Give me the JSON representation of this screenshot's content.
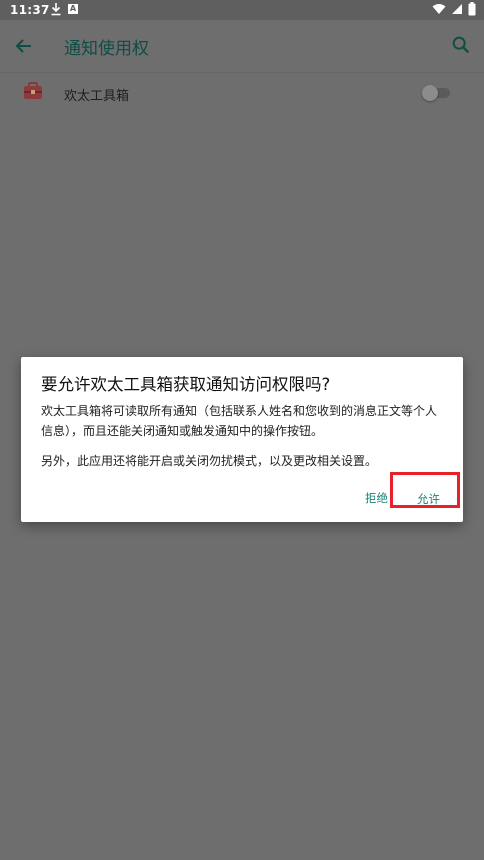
{
  "status_bar": {
    "time": "11:37",
    "notification_icons": [
      "download-icon",
      "a-badge-icon"
    ],
    "right_icons": [
      "wifi-icon",
      "signal-icon",
      "battery-icon"
    ]
  },
  "app_bar": {
    "title": "通知使用权"
  },
  "list": {
    "items": [
      {
        "label": "欢太工具箱",
        "toggle_on": false
      }
    ]
  },
  "dialog": {
    "title": "要允许欢太工具箱获取通知访问权限吗?",
    "body_1": "欢太工具箱将可读取所有通知（包括联系人姓名和您收到的消息正文等个人信息），而且还能关闭通知或触发通知中的操作按钮。",
    "body_2": "另外，此应用还将能开启或关闭勿扰模式，以及更改相关设置。",
    "deny_label": "拒绝",
    "allow_label": "允许"
  },
  "colors": {
    "accent": "#1a8578",
    "title": "#0f4d46",
    "highlight": "#e8202a",
    "scrim": "#6e6e6e"
  }
}
